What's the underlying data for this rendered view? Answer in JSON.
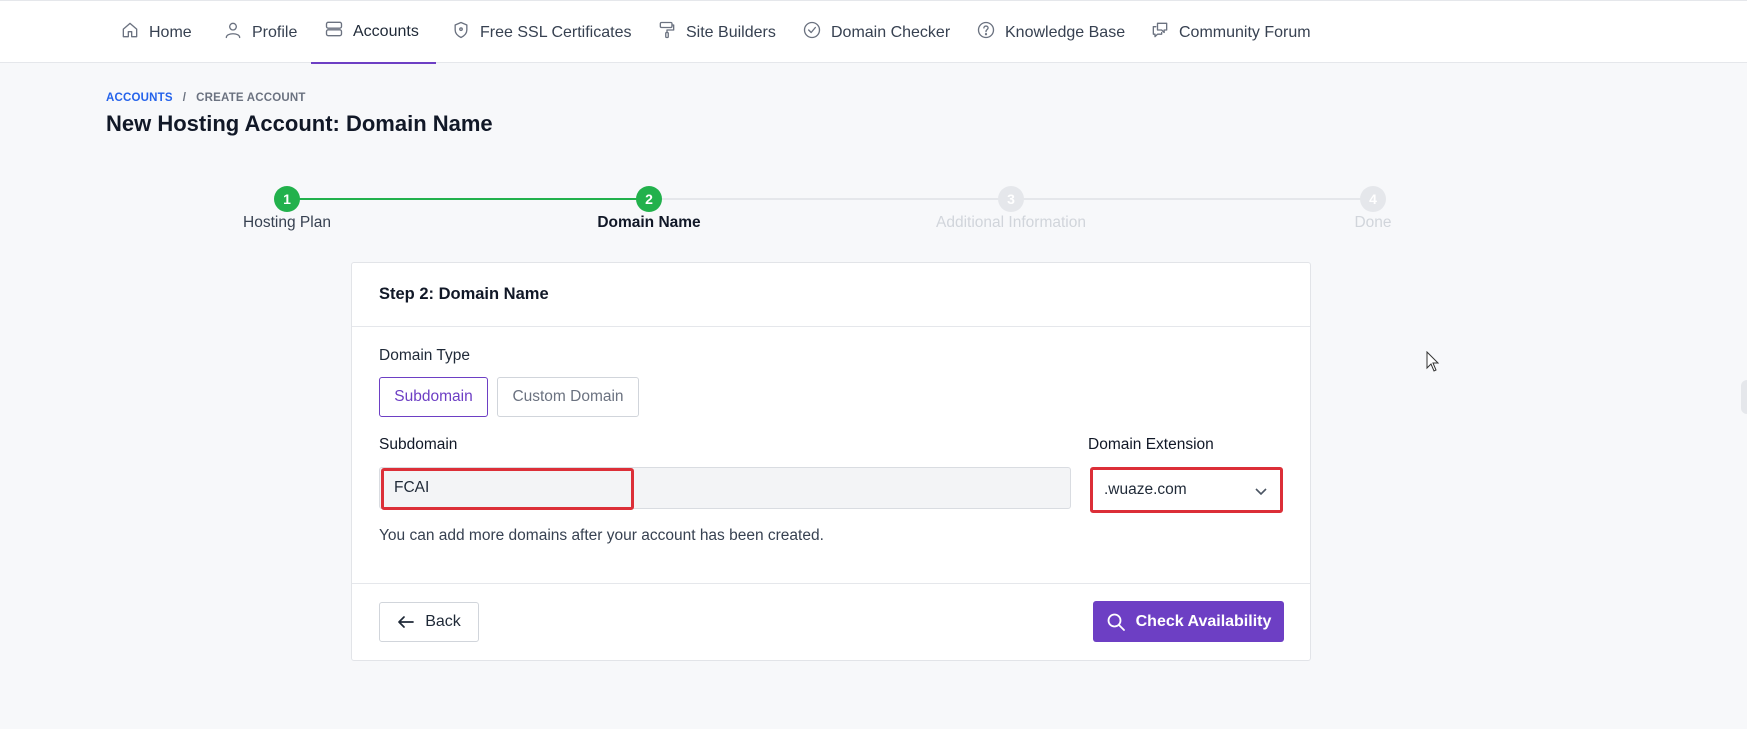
{
  "nav": {
    "items": [
      {
        "label": "Home",
        "icon": "home-icon"
      },
      {
        "label": "Profile",
        "icon": "user-icon"
      },
      {
        "label": "Accounts",
        "icon": "server-icon",
        "active": true
      },
      {
        "label": "Free SSL Certificates",
        "icon": "shield-icon"
      },
      {
        "label": "Site Builders",
        "icon": "paint-roller-icon"
      },
      {
        "label": "Domain Checker",
        "icon": "check-circle-icon"
      },
      {
        "label": "Knowledge Base",
        "icon": "help-circle-icon"
      },
      {
        "label": "Community Forum",
        "icon": "chat-icon"
      }
    ]
  },
  "breadcrumb": {
    "parent": "ACCOUNTS",
    "separator": "/",
    "current": "CREATE ACCOUNT"
  },
  "page": {
    "title": "New Hosting Account: Domain Name"
  },
  "stepper": {
    "steps": [
      {
        "number": "1",
        "label": "Hosting Plan",
        "state": "complete"
      },
      {
        "number": "2",
        "label": "Domain Name",
        "state": "current"
      },
      {
        "number": "3",
        "label": "Additional Information",
        "state": "upcoming"
      },
      {
        "number": "4",
        "label": "Done",
        "state": "upcoming"
      }
    ]
  },
  "card": {
    "title": "Step 2: Domain Name",
    "domain_type_label": "Domain Type",
    "domain_type_options": [
      "Subdomain",
      "Custom Domain"
    ],
    "domain_type_selected": "Subdomain",
    "subdomain_label": "Subdomain",
    "subdomain_value": "FCAI",
    "extension_label": "Domain Extension",
    "extension_value": ".wuaze.com",
    "help_text": "You can add more domains after your account has been created.",
    "back_label": "Back",
    "check_label": "Check Availability"
  },
  "colors": {
    "accent": "#6d3fc4",
    "success": "#22b14c",
    "highlight": "#dc2f38",
    "link": "#2563eb"
  }
}
